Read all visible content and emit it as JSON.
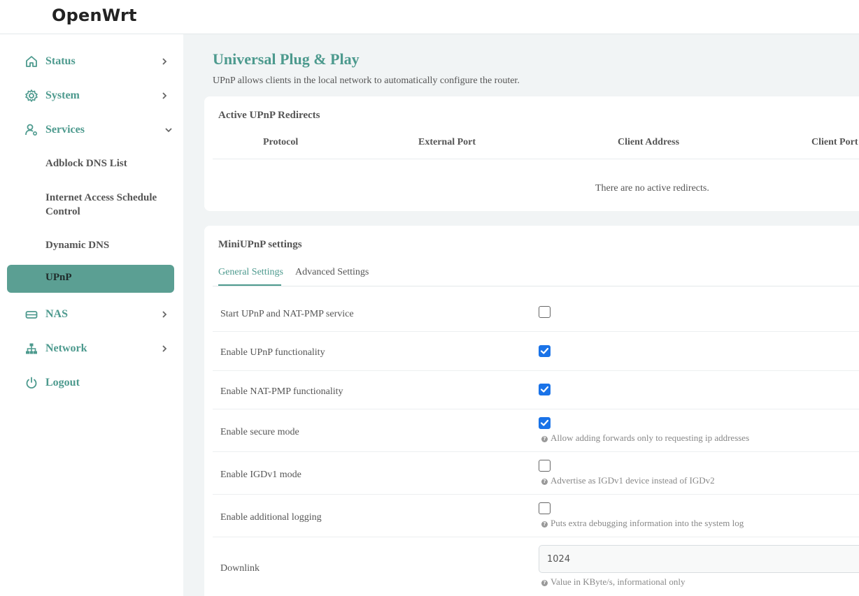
{
  "brand": "OpenWrt",
  "nav": {
    "status": "Status",
    "system": "System",
    "services": "Services",
    "services_sub": [
      "Adblock DNS List",
      "Internet Access Schedule Control",
      "Dynamic DNS",
      "UPnP"
    ],
    "nas": "NAS",
    "network": "Network",
    "logout": "Logout"
  },
  "page": {
    "title": "Universal Plug & Play",
    "description": "UPnP allows clients in the local network to automatically configure the router."
  },
  "redirects": {
    "title": "Active UPnP Redirects",
    "columns": [
      "Protocol",
      "External Port",
      "Client Address",
      "Client Port"
    ],
    "empty_text": "There are no active redirects."
  },
  "settings": {
    "title": "MiniUPnP settings",
    "tabs": [
      "General Settings",
      "Advanced Settings"
    ],
    "active_tab": "General Settings",
    "rows": [
      {
        "label": "Start UPnP and NAT-PMP service",
        "checked": false,
        "hint": ""
      },
      {
        "label": "Enable UPnP functionality",
        "checked": true,
        "hint": ""
      },
      {
        "label": "Enable NAT-PMP functionality",
        "checked": true,
        "hint": ""
      },
      {
        "label": "Enable secure mode",
        "checked": true,
        "hint": "Allow adding forwards only to requesting ip addresses"
      },
      {
        "label": "Enable IGDv1 mode",
        "checked": false,
        "hint": "Advertise as IGDv1 device instead of IGDv2"
      },
      {
        "label": "Enable additional logging",
        "checked": false,
        "hint": "Puts extra debugging information into the system log"
      }
    ],
    "downlink": {
      "label": "Downlink",
      "value": "1024",
      "hint": "Value in KByte/s, informational only"
    }
  },
  "colors": {
    "accent": "#4d9a8e",
    "active_bg": "#5b9f93",
    "checkbox": "#1a73e8"
  }
}
